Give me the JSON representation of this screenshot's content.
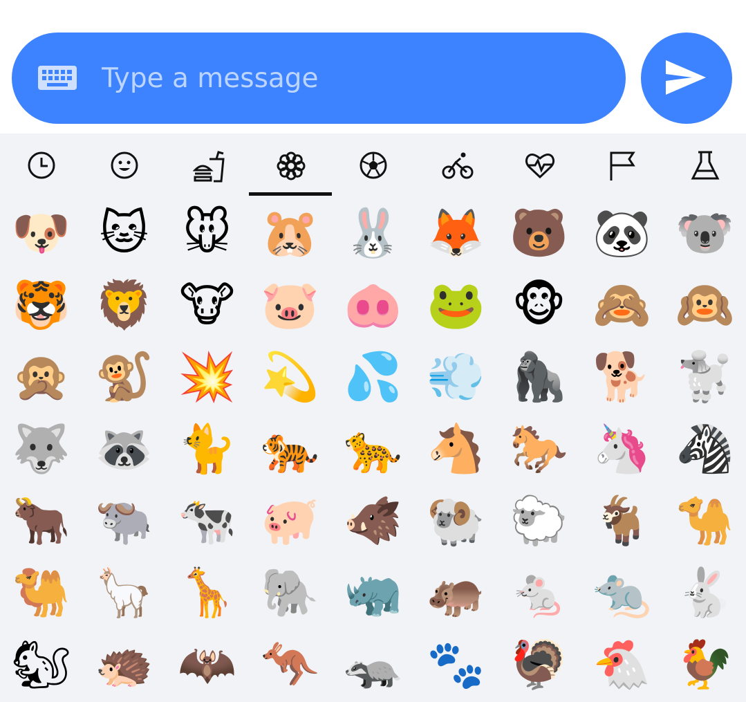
{
  "composer": {
    "placeholder": "Type a message",
    "value": "",
    "keyboard_icon": "keyboard-icon",
    "send_icon": "send-icon",
    "accent_color": "#3d82ff"
  },
  "picker": {
    "active_tab_index": 3,
    "tabs": [
      {
        "icon": "clock-icon",
        "category": "recent"
      },
      {
        "icon": "smiley-icon",
        "category": "smileys"
      },
      {
        "icon": "fastfood-icon",
        "category": "food"
      },
      {
        "icon": "flower-icon",
        "category": "animals-nature"
      },
      {
        "icon": "soccer-ball-icon",
        "category": "activities"
      },
      {
        "icon": "bicycle-icon",
        "category": "travel"
      },
      {
        "icon": "heart-pulse-icon",
        "category": "symbols"
      },
      {
        "icon": "flag-icon",
        "category": "flags"
      },
      {
        "icon": "flask-icon",
        "category": "objects"
      }
    ],
    "rows": [
      [
        "🐶",
        "🐱",
        "🐭",
        "🐹",
        "🐰",
        "🦊",
        "🐻",
        "🐼",
        "🐨"
      ],
      [
        "🐯",
        "🦁",
        "🐮",
        "🐷",
        "🐽",
        "🐸",
        "🐵",
        "🙈",
        "🙉"
      ],
      [
        "🙊",
        "🐒",
        "💥",
        "💫",
        "💦",
        "💨",
        "🦍",
        "🐕",
        "🐩"
      ],
      [
        "🐺",
        "🦝",
        "🐈",
        "🐅",
        "🐆",
        "🐴",
        "🐎",
        "🦄",
        "🦓"
      ],
      [
        "🐂",
        "🐃",
        "🐄",
        "🐖",
        "🐗",
        "🐏",
        "🐑",
        "🐐",
        "🐪"
      ],
      [
        "🐫",
        "🦙",
        "🦒",
        "🐘",
        "🦏",
        "🦛",
        "🐁",
        "🐀",
        "🐇"
      ],
      [
        "🐿",
        "🦔",
        "🦇",
        "🦘",
        "🦡",
        "🐾",
        "🦃",
        "🐔",
        "🐓"
      ]
    ]
  }
}
